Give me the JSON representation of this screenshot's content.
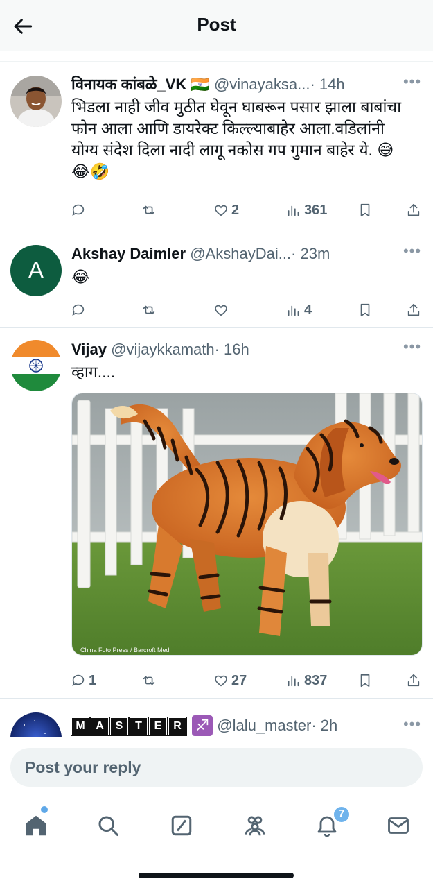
{
  "header": {
    "title": "Post"
  },
  "posts": [
    {
      "name": "विनायक कांबळे_VK",
      "flag": "🇮🇳",
      "handle": "@vinayaksa...",
      "time": "· 14h",
      "text": "भिडला नाही जीव मुठीत घेवून घाबरून पसार झाला बाबांचा फोन आला आणि डायरेक्ट किल्ल्याबाहेर आला.वडिलांनी योग्य संदेश दिला नादी लागू नकोस गप गुमान बाहेर ये. 😅😂🤣",
      "stats": {
        "replies": "",
        "reposts": "",
        "likes": "2",
        "views": "361"
      }
    },
    {
      "name": "Akshay Daimler",
      "avatar_letter": "A",
      "avatar_color": "#0d5c3f",
      "handle": "@AkshayDai...",
      "time": "· 23m",
      "text": "😂",
      "stats": {
        "replies": "",
        "reposts": "",
        "likes": "",
        "views": "4"
      }
    },
    {
      "name": "Vijay",
      "handle": "@vijaykkamath",
      "time": "· 16h",
      "text": "व्हाग....",
      "image_credit": "China Foto Press / Barcroft Medi",
      "stats": {
        "replies": "1",
        "reposts": "",
        "likes": "27",
        "views": "837"
      }
    },
    {
      "name_tiles": [
        "M",
        "A",
        "S",
        "T",
        "E",
        "R"
      ],
      "emoji": "♐",
      "handle": "@lalu_master",
      "time": "· 2h"
    }
  ],
  "reply_bar": {
    "placeholder": "Post your reply"
  },
  "tabbar": {
    "notification_count": "7"
  },
  "colors": {
    "accent": "#1d9bf0",
    "secondary_text": "#536471",
    "badge": "#6fb3ec"
  }
}
